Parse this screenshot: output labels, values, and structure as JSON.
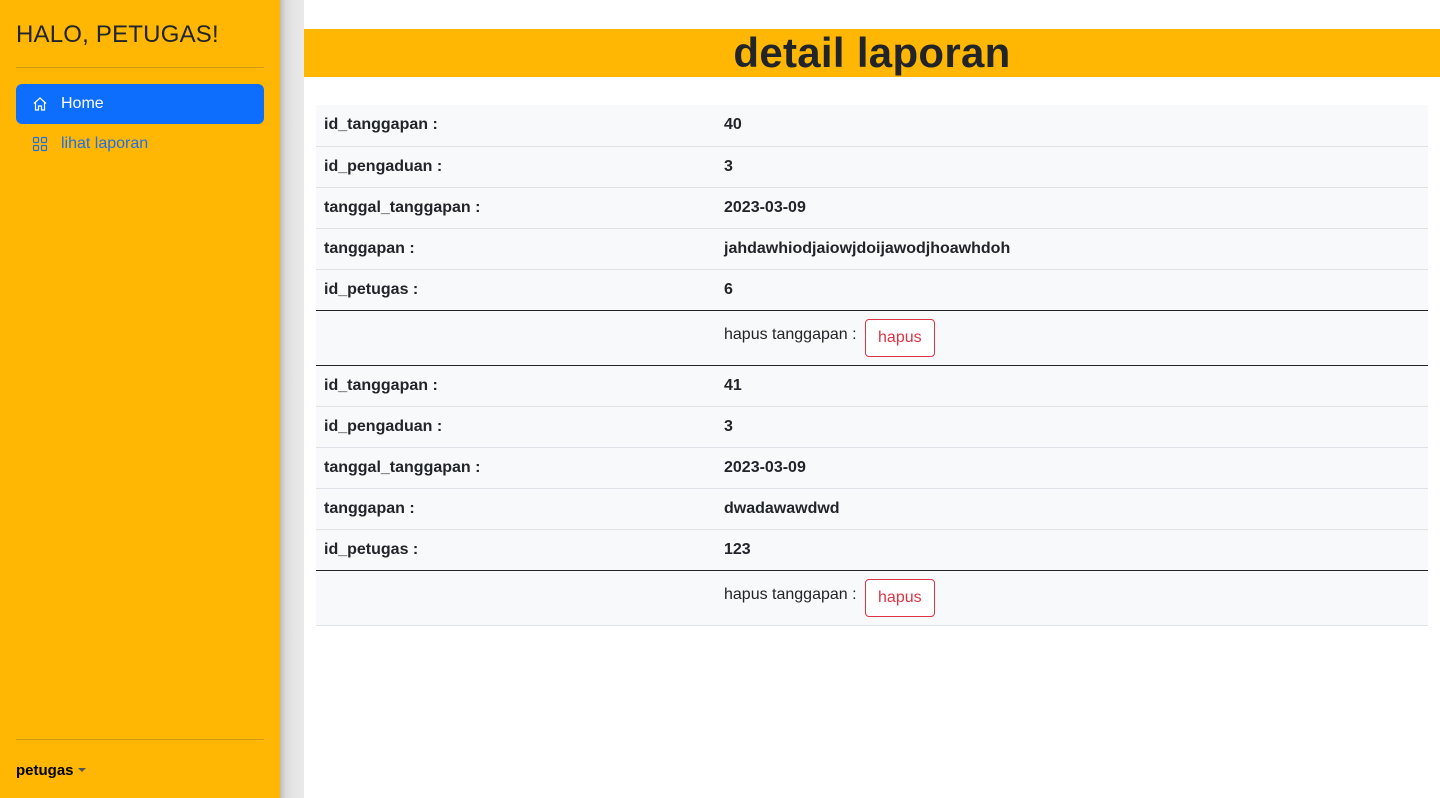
{
  "sidebar": {
    "brand": "HALO, PETUGAS!",
    "items": [
      {
        "label": "Home",
        "icon": "home-icon",
        "active": true
      },
      {
        "label": "lihat laporan",
        "icon": "grid-icon",
        "active": false
      }
    ],
    "user": "petugas"
  },
  "header": {
    "title": "detail laporan"
  },
  "colors": {
    "accent": "#ffb703",
    "primary": "#0d6efd",
    "danger": "#dc3545"
  },
  "labels": {
    "id_tanggapan": "id_tanggapan :",
    "id_pengaduan": "id_pengaduan :",
    "tanggal_tanggapan": "tanggal_tanggapan :",
    "tanggapan": "tanggapan :",
    "id_petugas": "id_petugas :",
    "hapus_tanggapan": "hapus tanggapan :",
    "hapus_button": "hapus"
  },
  "records": [
    {
      "id_tanggapan": "40",
      "id_pengaduan": "3",
      "tanggal_tanggapan": "2023-03-09",
      "tanggapan": "jahdawhiodjaiowjdoijawodjhoawhdoh",
      "id_petugas": "6"
    },
    {
      "id_tanggapan": "41",
      "id_pengaduan": "3",
      "tanggal_tanggapan": "2023-03-09",
      "tanggapan": "dwadawawdwd",
      "id_petugas": "123"
    }
  ]
}
